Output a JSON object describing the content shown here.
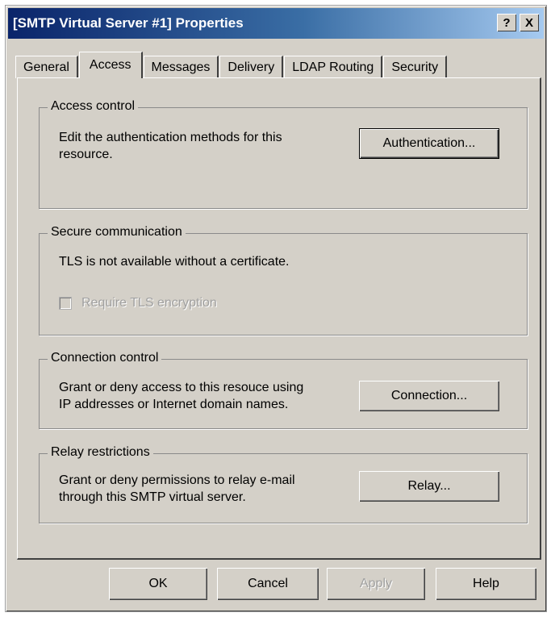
{
  "window": {
    "title": "[SMTP Virtual Server #1] Properties",
    "help_button": "?",
    "close_button": "X"
  },
  "tabs": [
    {
      "label": "General"
    },
    {
      "label": "Access",
      "active": true
    },
    {
      "label": "Messages"
    },
    {
      "label": "Delivery"
    },
    {
      "label": "LDAP Routing"
    },
    {
      "label": "Security"
    }
  ],
  "access_control": {
    "legend": "Access control",
    "description_line1": "Edit the authentication methods for this",
    "description_line2": "resource.",
    "button": "Authentication..."
  },
  "secure_communication": {
    "legend": "Secure communication",
    "description": "TLS is not available without a certificate.",
    "checkbox_label": "Require TLS encryption",
    "checkbox_checked": false,
    "checkbox_enabled": false
  },
  "connection_control": {
    "legend": "Connection control",
    "description_line1": "Grant or deny access to this resouce using",
    "description_line2": "IP addresses or Internet domain names.",
    "button": "Connection..."
  },
  "relay_restrictions": {
    "legend": "Relay restrictions",
    "description_line1": "Grant or deny permissions to relay e-mail",
    "description_line2": "through this SMTP virtual server.",
    "button": "Relay..."
  },
  "footer": {
    "ok": "OK",
    "cancel": "Cancel",
    "apply": "Apply",
    "help": "Help"
  },
  "colors": {
    "dialog_face": "#d4d0c8",
    "titlebar_start": "#0a246a",
    "titlebar_end": "#a6caf0",
    "disabled_text": "#a0a0a0"
  }
}
